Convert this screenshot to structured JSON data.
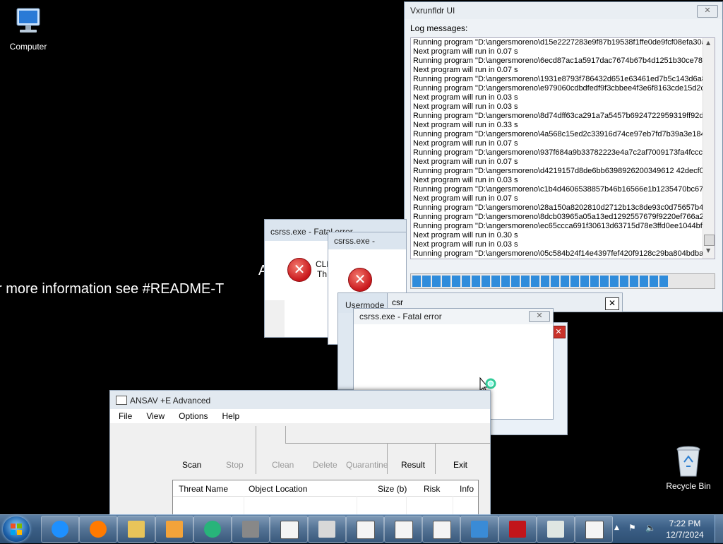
{
  "desktop": {
    "icons": [
      {
        "label": "Computer"
      },
      {
        "label": "Recycle Bin"
      }
    ],
    "background_text": {
      "line1_fragment": "A",
      "line2": "r more information see #README-T"
    }
  },
  "vxrunfldr": {
    "title": "Vxrunfldr UI",
    "log_label": "Log messages:",
    "log_lines": [
      "Running program \"D:\\angersmoreno\\d15e2227283e9f87b19538f1ffe0de9fcf08efa30a9",
      "Next program will run in 0.07 s",
      "Running program \"D:\\angersmoreno\\6ecd87ac1a5917dac7674b67b4d1251b30ce784",
      "Next program will run in 0.07 s",
      "Running program \"D:\\angersmoreno\\1931e8793f786432d651e63461ed7b5c143d6a85",
      "Running program \"D:\\angersmoreno\\e979060cdbdfedf9f3cbbee4f3e6f8163cde15d2ce",
      "Next program will run in 0.03 s",
      "Next program will run in 0.03 s",
      "Running program \"D:\\angersmoreno\\8d74dff63ca291a7a5457b6924722959319ff92d8",
      "Next program will run in 0.33 s",
      "Running program \"D:\\angersmoreno\\4a568c15ed2c33916d74ce97eb7fd7b39a3e184c",
      "Next program will run in 0.07 s",
      "Running program \"D:\\angersmoreno\\937f684a9b33782223e4a7c2af7009173fa4fccc2",
      "Next program will run in 0.07 s",
      "Running program \"D:\\angersmoreno\\d4219157d8de6bb6398926200349612 42decf0a4",
      "Next program will run in 0.03 s",
      "Running program \"D:\\angersmoreno\\c1b4d4606538857b46b16566e1b1235470bc676",
      "Next program will run in 0.07 s",
      "Running program \"D:\\angersmoreno\\28a150a8202810d2712b13c8de93c0d75657b4b",
      "Running program \"D:\\angersmoreno\\8dcb03965a05a13ed1292557679f9220ef766a21",
      "Running program \"D:\\angersmoreno\\ec65ccca691f30613d63715d78e3ffd0ee1044bf3",
      "Next program will run in 0.30 s",
      "Next program will run in 0.03 s",
      "Running program \"D:\\angersmoreno\\05c584b24f14e4397fef420f9128c29ba804bdbac"
    ],
    "progress_segments": 26,
    "progress_fraction": 0.85
  },
  "error_dialogs": {
    "back_title": "csrss.exe - Fatal error",
    "back_text1": "CLR",
    "back_text2": "Th",
    "mid_title": "csrss.exe -",
    "usermode_title": "Usermode",
    "csr_title": "csr",
    "front_title": "csrss.exe - Fatal error"
  },
  "ansav": {
    "title": "ANSAV +E Advanced",
    "menu": [
      "File",
      "View",
      "Options",
      "Help"
    ],
    "toolbar": {
      "scan": "Scan",
      "stop": "Stop",
      "clean": "Clean",
      "delete": "Delete",
      "quarantine": "Quarantine",
      "result": "Result",
      "exit": "Exit"
    },
    "columns": [
      "Threat Name",
      "Object Location",
      "Size (b)",
      "Risk",
      "Info"
    ]
  },
  "taskbar": {
    "time": "7:22 PM",
    "date": "12/7/2024",
    "pinned": [
      "internet-explorer-icon",
      "firefox-icon",
      "explorer-icon",
      "media-player-icon",
      "green-app-icon",
      "printer-app-icon",
      "exe-icon",
      "pdf-icon",
      "exe-icon",
      "exe-icon",
      "exe-icon",
      "installer-icon",
      "red-app-icon",
      "window-app-icon",
      "exe-icon"
    ]
  }
}
